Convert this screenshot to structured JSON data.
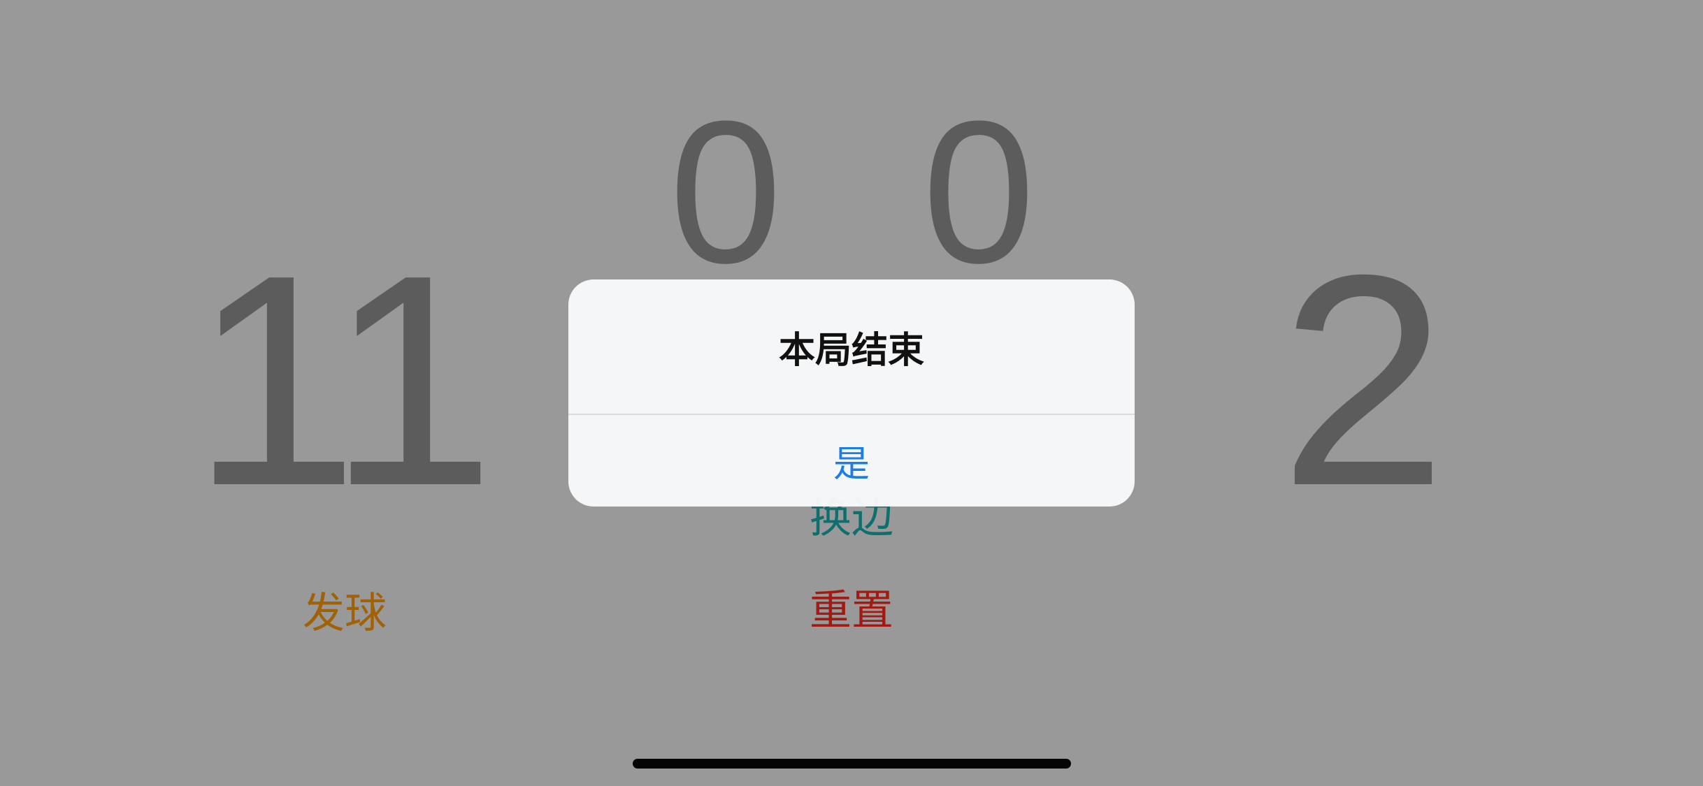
{
  "scoreboard": {
    "left_score": "11",
    "right_score": "2",
    "left_games": "0",
    "right_games": "0"
  },
  "actions": {
    "serve_label": "发球",
    "swap_label": "换边",
    "reset_label": "重置"
  },
  "alert": {
    "title": "本局结束",
    "confirm_label": "是"
  },
  "colors": {
    "background": "#999999",
    "score": "#5c5c5c",
    "serve": "#a16207",
    "swap": "#0f6e6e",
    "reset": "#a11b12",
    "alert_button": "#1a7ee6"
  }
}
